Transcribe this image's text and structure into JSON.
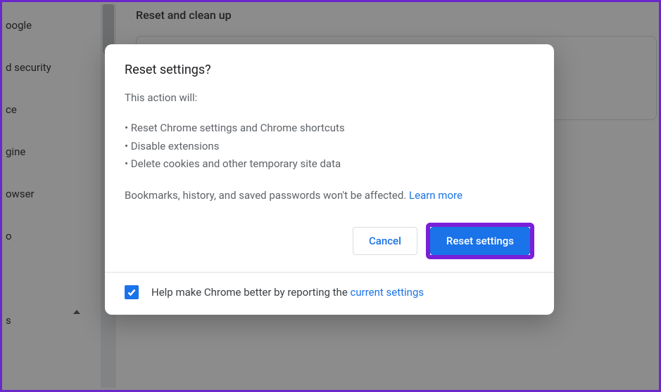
{
  "sidebar": {
    "items": [
      {
        "label": "oogle"
      },
      {
        "label": "d security"
      },
      {
        "label": "ce"
      },
      {
        "label": "gine"
      },
      {
        "label": "owser"
      },
      {
        "label": "o"
      },
      {
        "label": ""
      },
      {
        "label": "s"
      }
    ]
  },
  "main": {
    "section_title": "Reset and clean up"
  },
  "dialog": {
    "title": "Reset settings?",
    "lead": "This action will:",
    "bullets": [
      "Reset Chrome settings and Chrome shortcuts",
      "Disable extensions",
      "Delete cookies and other temporary site data"
    ],
    "note_text": "Bookmarks, history, and saved passwords won't be affected. ",
    "learn_more": "Learn more",
    "cancel": "Cancel",
    "confirm": "Reset settings",
    "footer_text_a": "Help make Chrome better by reporting the ",
    "footer_link": "current settings",
    "checkbox_checked": true
  }
}
